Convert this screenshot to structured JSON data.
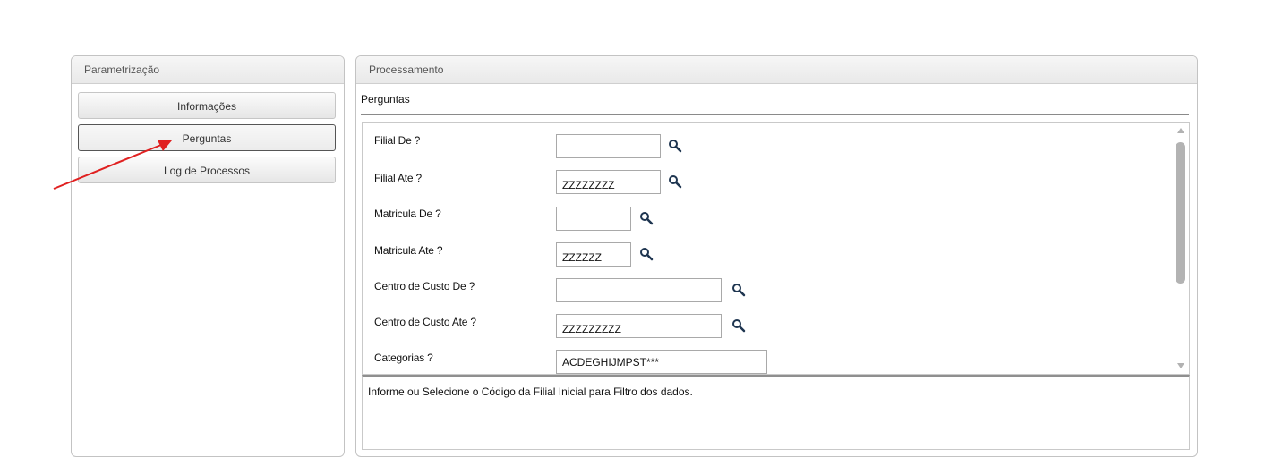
{
  "left_panel": {
    "title": "Parametrização",
    "items": [
      {
        "label": "Informações"
      },
      {
        "label": "Perguntas"
      },
      {
        "label": "Log de Processos"
      }
    ]
  },
  "right_panel": {
    "title": "Processamento",
    "section_title": "Perguntas",
    "questions": [
      {
        "label": "Filial De ?",
        "value": ""
      },
      {
        "label": "Filial Ate ?",
        "value": "ZZZZZZZZ"
      },
      {
        "label": "Matricula De ?",
        "value": ""
      },
      {
        "label": "Matricula Ate ?",
        "value": "ZZZZZZ"
      },
      {
        "label": "Centro de Custo De ?",
        "value": ""
      },
      {
        "label": "Centro de Custo Ate ?",
        "value": "ZZZZZZZZZ"
      },
      {
        "label": "Categorias ?",
        "value": "ACDEGHIJMPST***"
      }
    ],
    "help_text": "Informe ou Selecione o Código da Filial Inicial para Filtro dos dados."
  },
  "icons": {
    "search": "magnifier-icon",
    "annotation": "red-arrow"
  },
  "colors": {
    "annotation_arrow": "#e02020"
  }
}
